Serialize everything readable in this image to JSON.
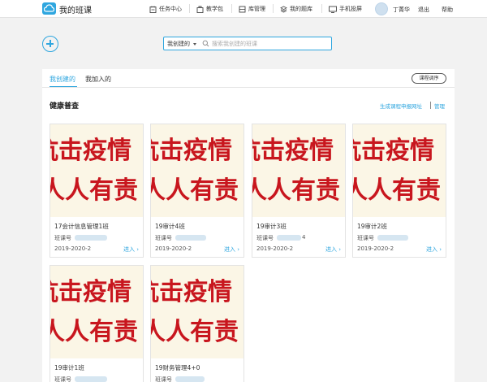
{
  "header": {
    "app_title": "我的班课",
    "nav": [
      {
        "label": "任务中心",
        "icon": "task-center-icon"
      },
      {
        "label": "教学包",
        "icon": "teaching-package-icon"
      },
      {
        "label": "库管理",
        "icon": "library-icon"
      },
      {
        "label": "我的题库",
        "icon": "question-bank-icon"
      },
      {
        "label": "手机投屏",
        "icon": "phone-cast-icon"
      }
    ],
    "user_name": "丁菁华",
    "logout": "退出",
    "help": "帮助"
  },
  "search": {
    "scope": "我创建的",
    "placeholder": "搜索我创建的班课"
  },
  "tabs": [
    {
      "label": "我创建的",
      "active": true
    },
    {
      "label": "我加入的",
      "active": false
    }
  ],
  "sort_button": "课程调序",
  "group": {
    "title": "健康普查",
    "generate_link": "生成课程申报网址",
    "manage_link": "管理"
  },
  "cover": {
    "line1": "抗击疫情",
    "line2": "人人有责",
    "text_color": "#c8161e",
    "background": "#fbf6e6"
  },
  "code_label": "班课号",
  "enter_label": "进入",
  "classes": [
    {
      "name": "17会计信息管理1班",
      "term": "2019-2020-2"
    },
    {
      "name": "19审计4班",
      "term": "2019-2020-2"
    },
    {
      "name": "19审计3班",
      "term": "2019-2020-2",
      "code_tail": "4"
    },
    {
      "name": "19审计2班",
      "term": "2019-2020-2"
    },
    {
      "name": "19审计1班",
      "term": ""
    },
    {
      "name": "19财务管理4+0",
      "term": ""
    }
  ],
  "accent_color": "#2fa6df"
}
